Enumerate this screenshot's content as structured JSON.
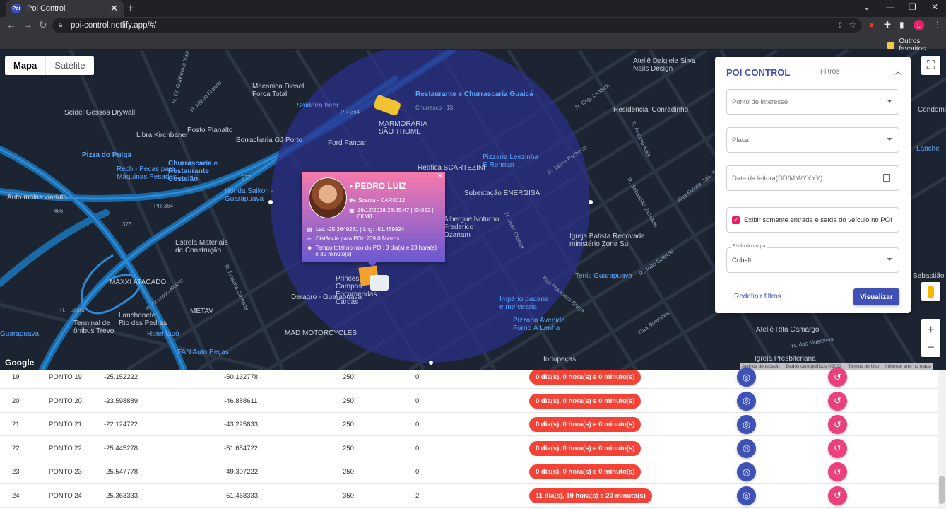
{
  "browser": {
    "tab_title": "Poi Control",
    "favicon": "Poi",
    "url": "poi-control.netlify.app/#/",
    "profile_initial": "L",
    "bookmark_folder": "Outros favoritos"
  },
  "map": {
    "type_buttons": [
      "Mapa",
      "Satélite"
    ],
    "google": "Google",
    "attribution": [
      "Atalhos do teclado",
      "Dados cartográficos ©2022",
      "Termos de Uso",
      "Informar erro no mapa"
    ],
    "circle_color": "#2a2f8a",
    "places": [
      {
        "id": "p1",
        "text": "Restaurante e Churrascaria Guaicá"
      },
      {
        "id": "p2",
        "text": "Churrasco · $$"
      },
      {
        "id": "p3",
        "text": "MARMORARIA SÃO THOME"
      },
      {
        "id": "p4",
        "text": "Pizza do Pulga"
      },
      {
        "id": "p5",
        "text": "Rech - Peças para Máquinas Pesadas..."
      },
      {
        "id": "p6",
        "text": "Churrascaria e Restaurante Costelão"
      },
      {
        "id": "p7",
        "text": "Honda Saikon - Guarapuava"
      },
      {
        "id": "p8",
        "text": "Estrela Materiais de Construção"
      },
      {
        "id": "p9",
        "text": "MAXXI ATACADO"
      },
      {
        "id": "p10",
        "text": "Lanchonete Rio das Pedras"
      },
      {
        "id": "p11",
        "text": "Hotel Iapó"
      },
      {
        "id": "p12",
        "text": "FAN Auto Peças"
      },
      {
        "id": "p13",
        "text": "MAD MOTORCYCLES"
      },
      {
        "id": "p14",
        "text": "Deragro - Guarapuava"
      },
      {
        "id": "p15",
        "text": "Império padaria e mercearia"
      },
      {
        "id": "p16",
        "text": "Pizzaria Avenida Forno À Lenha"
      },
      {
        "id": "p17",
        "text": "Tenis Guarapuava"
      },
      {
        "id": "p18",
        "text": "Igreja Batista Renovada ministério Zona Sul"
      },
      {
        "id": "p19",
        "text": "Subestação ENERGISA"
      },
      {
        "id": "p20",
        "text": "Pizzaria Leezinha E Rennan"
      },
      {
        "id": "p21",
        "text": "Residencial Conradinho"
      },
      {
        "id": "p22",
        "text": "Ateliê Dalgiele Silva Nails Design"
      },
      {
        "id": "p23",
        "text": "Mecanica Diesel Forca Total"
      },
      {
        "id": "p24",
        "text": "Seidel Gessos Drywall"
      },
      {
        "id": "p25",
        "text": "Libra Kirchbaner"
      },
      {
        "id": "p26",
        "text": "Posto Planalto"
      },
      {
        "id": "p27",
        "text": "Borracharia GJ Porto"
      },
      {
        "id": "p28",
        "text": "Ford Fancar"
      },
      {
        "id": "p29",
        "text": "Retífica SCARTEZINI"
      },
      {
        "id": "p30",
        "text": "Albergue Noturno Frederico Ozanam"
      },
      {
        "id": "p31",
        "text": "Auto molas viaduto"
      },
      {
        "id": "p32",
        "text": "Terminal de ônibus Trevo"
      },
      {
        "id": "p33",
        "text": "METAV"
      },
      {
        "id": "p34",
        "text": "Ateliê Rita Camargo"
      },
      {
        "id": "p35",
        "text": "Igreja Presbiteriana"
      },
      {
        "id": "p36",
        "text": "Indupeças"
      },
      {
        "id": "p37",
        "text": "Princesa dos Campos Encomendas Cargas"
      },
      {
        "id": "p38",
        "text": "Saideira beer"
      },
      {
        "id": "p39",
        "text": "Guarapuava"
      },
      {
        "id": "p40",
        "text": "Sebastião E"
      },
      {
        "id": "p41",
        "text": "Condominio"
      },
      {
        "id": "p42",
        "text": "Lanche"
      }
    ],
    "streets": [
      {
        "id": "s1",
        "text": "R. Jaime Pacheco"
      },
      {
        "id": "s2",
        "text": "R. Antônio Kais"
      },
      {
        "id": "s3",
        "text": "R. Eng. Lentsch"
      },
      {
        "id": "s4",
        "text": "Rua Francisco Braga"
      },
      {
        "id": "s5",
        "text": "Rua Sorocaba"
      },
      {
        "id": "s6",
        "text": "R. João Gelinski"
      },
      {
        "id": "s7",
        "text": "R. Jean Granier"
      },
      {
        "id": "s8",
        "text": "R. Conrado Kluber"
      },
      {
        "id": "s9",
        "text": "R. Tucurui"
      },
      {
        "id": "s10",
        "text": "R. Rosana Campos"
      },
      {
        "id": "s11",
        "text": "R. Flávio Franco"
      },
      {
        "id": "s12",
        "text": "R. Dr. Guilherme Vieira"
      },
      {
        "id": "s13",
        "text": "R. Sebastião Jassauki"
      },
      {
        "id": "s14",
        "text": "R. das Mueleiras"
      },
      {
        "id": "s15",
        "text": "Rua Eulália Cais Tokarski"
      },
      {
        "id": "s16",
        "text": "PR-364"
      },
      {
        "id": "s17",
        "text": "PR-364"
      },
      {
        "id": "s18",
        "text": "277"
      },
      {
        "id": "s19",
        "text": "373"
      },
      {
        "id": "s20",
        "text": "466"
      }
    ]
  },
  "popup": {
    "name": "PEDRO LUIZ",
    "vehicle": "Scania - CAR0012",
    "datetime": "16/12/2018 23:45:47 | ID:952 | 0KM/H",
    "coords": "Lat: -25.3649281 | Lng: -51.469924",
    "distance": "Distância para POI: 239.0 Metros",
    "time_total": "Tempo total no raio do POI: 3 dia(s) e 23 hora(s) e 39 minuto(s)"
  },
  "panel": {
    "title": "POI CONTROL",
    "filters_label": "Filtros",
    "poi_placeholder": "Ponto de interesse",
    "plate_placeholder": "Placa",
    "date_placeholder": "Data da leitura(DD/MM/YYYY)",
    "checkbox_label": "Exibir somente entrada e saída do veículo no POI",
    "style_label": "Estilo do mapa",
    "style_value": "Cobalt",
    "reset_label": "Redefinir filtros",
    "view_label": "Visualizar"
  },
  "table": {
    "rows": [
      {
        "id": "19",
        "name": "PONTO 19",
        "lat": "-25.152222",
        "lng": "-50.132778",
        "radius": "250",
        "count": "0",
        "time": "0 dia(s), 0 hora(s) e 0 minuto(s)"
      },
      {
        "id": "20",
        "name": "PONTO 20",
        "lat": "-23.598889",
        "lng": "-46.888611",
        "radius": "250",
        "count": "0",
        "time": "0 dia(s), 0 hora(s) e 0 minuto(s)"
      },
      {
        "id": "21",
        "name": "PONTO 21",
        "lat": "-22.124722",
        "lng": "-43.225833",
        "radius": "250",
        "count": "0",
        "time": "0 dia(s), 0 hora(s) e 0 minuto(s)"
      },
      {
        "id": "22",
        "name": "PONTO 22",
        "lat": "-25.445278",
        "lng": "-51.654722",
        "radius": "250",
        "count": "0",
        "time": "0 dia(s), 0 hora(s) e 0 minuto(s)"
      },
      {
        "id": "23",
        "name": "PONTO 23",
        "lat": "-25.547778",
        "lng": "-49.307222",
        "radius": "250",
        "count": "0",
        "time": "0 dia(s), 0 hora(s) e 0 minuto(s)"
      },
      {
        "id": "24",
        "name": "PONTO 24",
        "lat": "-25.363333",
        "lng": "-51.468333",
        "radius": "350",
        "count": "2",
        "time": "11 dia(s), 19 hora(s) e 20 minuto(s)"
      }
    ]
  }
}
